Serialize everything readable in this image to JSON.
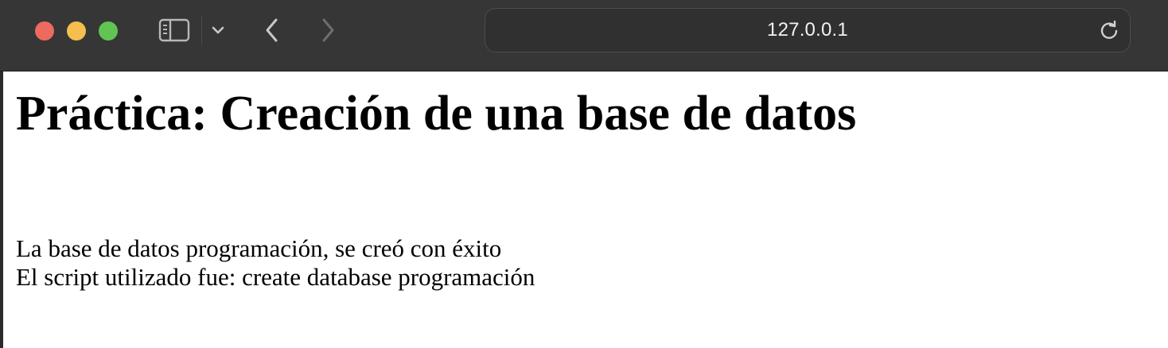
{
  "browser": {
    "address": "127.0.0.1",
    "icons": {
      "close": "close-window-icon",
      "minimize": "minimize-window-icon",
      "zoom": "zoom-window-icon",
      "sidebar": "sidebar-icon",
      "tab_menu": "chevron-down-icon",
      "back": "chevron-left-icon",
      "forward": "chevron-right-icon",
      "reload": "reload-icon"
    },
    "colors": {
      "toolbar": "#363636",
      "close": "#ec6a5e",
      "minimize": "#f4bf4f",
      "zoom": "#61c554"
    }
  },
  "page": {
    "title": "Práctica: Creación de una base de datos",
    "line1": "La base de datos programación, se creó con éxito",
    "line2": "El script utilizado fue: create database programación"
  }
}
